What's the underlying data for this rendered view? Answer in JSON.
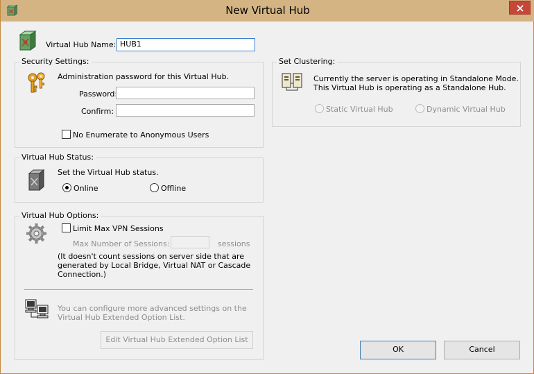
{
  "window": {
    "title": "New Virtual Hub"
  },
  "hub_name": {
    "label": "Virtual Hub Name:",
    "value": "HUB1"
  },
  "security": {
    "title": "Security Settings:",
    "description": "Administration password for this Virtual Hub.",
    "password_label": "Password:",
    "password_value": "",
    "confirm_label": "Confirm:",
    "confirm_value": "",
    "no_enumerate_label": "No Enumerate to Anonymous Users"
  },
  "status": {
    "title": "Virtual Hub Status:",
    "description": "Set the Virtual Hub status.",
    "online_label": "Online",
    "offline_label": "Offline",
    "selected": "online"
  },
  "options": {
    "title": "Virtual Hub Options:",
    "limit_label": "Limit Max VPN Sessions",
    "max_sessions_label": "Max Number of Sessions:",
    "max_sessions_value": "",
    "sessions_unit": "sessions",
    "note_line1": "(It doesn't count sessions on server side that are",
    "note_line2": "generated by Local Bridge, Virtual NAT or Cascade",
    "note_line3": "Connection.)",
    "advanced_line1": "You can configure more advanced settings on the",
    "advanced_line2": "Virtual Hub Extended Option List.",
    "edit_button": "Edit Virtual Hub Extended Option List"
  },
  "clustering": {
    "title": "Set Clustering:",
    "line1": "Currently the server is operating in Standalone Mode.",
    "line2": "This Virtual Hub is operating as a Standalone Hub.",
    "static_label": "Static Virtual Hub",
    "dynamic_label": "Dynamic Virtual Hub"
  },
  "buttons": {
    "ok": "OK",
    "cancel": "Cancel"
  },
  "colors": {
    "titlebar": "#d5b483",
    "close": "#c7463a",
    "dialog_bg": "#f0f0f0",
    "focus_border": "#3a7fcf"
  }
}
